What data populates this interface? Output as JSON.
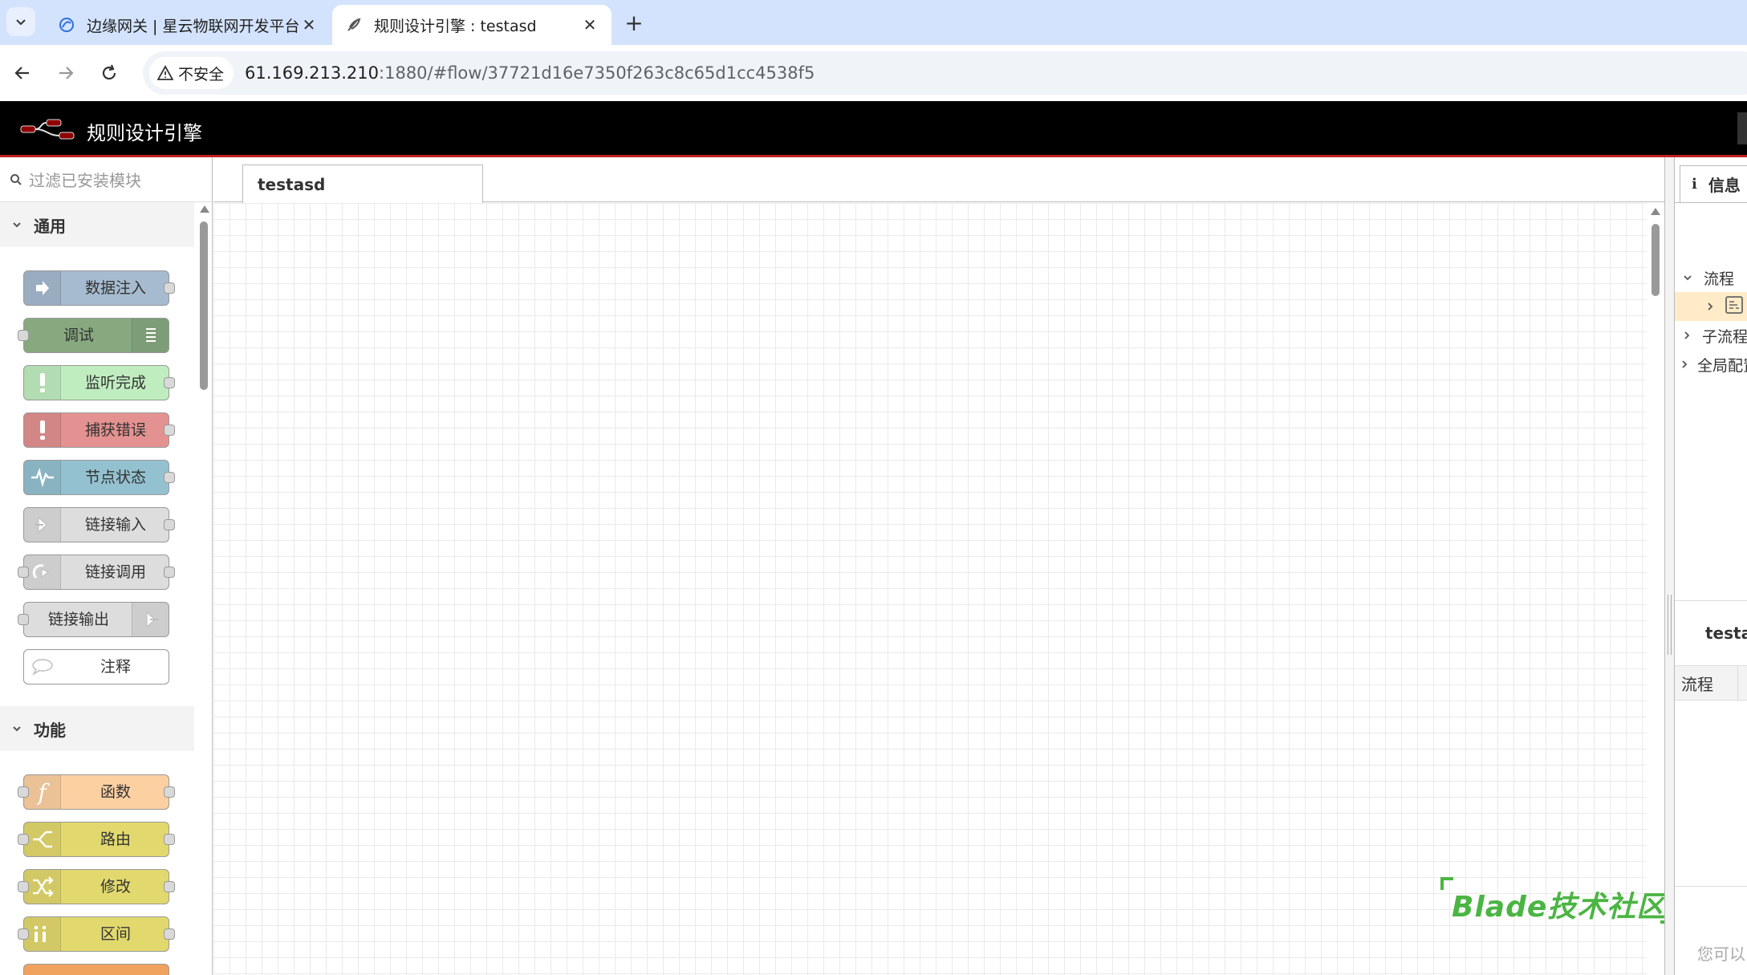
{
  "browser": {
    "tabs": [
      {
        "title": "边缘网关 | 星云物联网开发平台",
        "active": false,
        "favicon": "nebula-icon"
      },
      {
        "title": "规则设计引擎 : testasd",
        "active": true,
        "favicon": "feather-icon"
      }
    ],
    "security_label": "不安全",
    "url_host": "61.169.213.210",
    "url_rest": ":1880/#flow/37721d16e7350f263c8c65d1cc4538f5"
  },
  "app": {
    "title": "规则设计引擎"
  },
  "palette": {
    "search_placeholder": "过滤已安装模块",
    "categories": [
      {
        "label": "通用",
        "nodes": [
          {
            "label": "数据注入",
            "color": "#a6bbcf",
            "icon": "inject-arrow-icon"
          },
          {
            "label": "调试",
            "color": "#87a980",
            "icon": "debug-list-icon"
          },
          {
            "label": "监听完成",
            "color": "#c0edc0",
            "icon": "complete-exclamation-icon"
          },
          {
            "label": "捕获错误",
            "color": "#e49191",
            "icon": "catch-exclamation-icon"
          },
          {
            "label": "节点状态",
            "color": "#94c1d0",
            "icon": "status-pulse-icon"
          },
          {
            "label": "链接输入",
            "color": "#dddddd",
            "icon": "link-in-icon"
          },
          {
            "label": "链接调用",
            "color": "#dddddd",
            "icon": "link-call-icon"
          },
          {
            "label": "链接输出",
            "color": "#dddddd",
            "icon": "link-out-icon"
          },
          {
            "label": "注释",
            "color": "#ffffff",
            "icon": "comment-bubble-icon"
          }
        ]
      },
      {
        "label": "功能",
        "nodes": [
          {
            "label": "函数",
            "color": "#fdd0a2",
            "icon": "function-icon"
          },
          {
            "label": "路由",
            "color": "#e2d96e",
            "icon": "switch-icon"
          },
          {
            "label": "修改",
            "color": "#e2d96e",
            "icon": "change-icon"
          },
          {
            "label": "区间",
            "color": "#e2d96e",
            "icon": "range-icon"
          }
        ]
      }
    ]
  },
  "workspace": {
    "active_tab": "testasd"
  },
  "watermark": "Blade技术社区",
  "sidebar": {
    "tab_label": "信息",
    "tree": [
      {
        "label": "流程",
        "expanded": true
      },
      {
        "label": "",
        "selected": true
      },
      {
        "label": "子流程",
        "expanded": false
      },
      {
        "label": "全局配置节点",
        "expanded": false
      }
    ],
    "detail_title": "testasd",
    "detail_row_label": "流程",
    "help_text": "您可以"
  }
}
